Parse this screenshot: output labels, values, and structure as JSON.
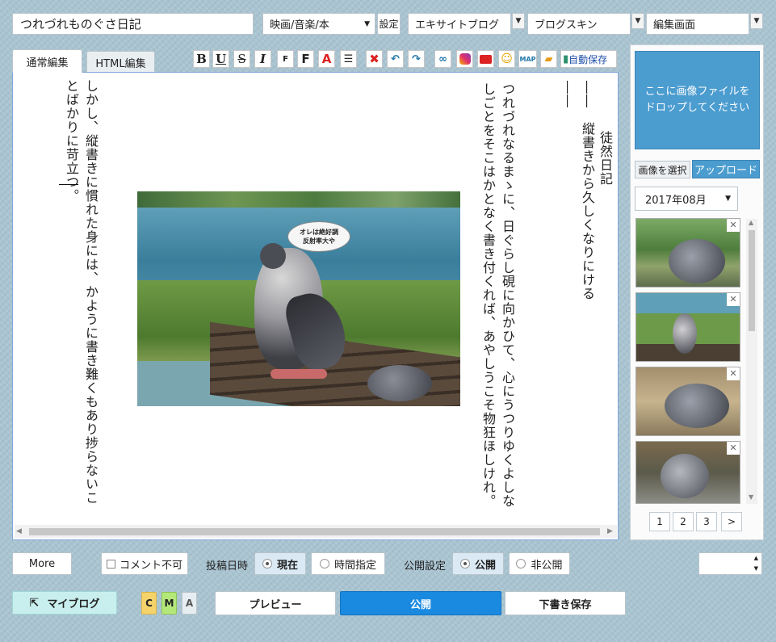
{
  "header": {
    "title": "つれづれものぐさ日記",
    "category": "映画/音楽/本",
    "settings": "設定",
    "blog": "エキサイトブログ",
    "skin": "ブログスキン",
    "screen": "編集画面"
  },
  "tabs": {
    "normal": "通常編集",
    "html": "HTML編集"
  },
  "toolbar": {
    "autosave": "自動保存",
    "map": "MAP"
  },
  "editor": {
    "title_vertical": "徒然日記",
    "line2": "――　縦書きから久しくなりにける――",
    "line3": "つれづれなるまゝに、日ぐらし硯に向かひて、心にうつりゆくよしなしごとをそこはかとなく書き付くれば、あやしうこそ物狂ほしけれ。",
    "line4": "しかし、縦書きに慣れた身には、かように書き難くもあり捗らないことばかりに苛立つ。",
    "speech": "オレは絶好調\n反射率大や"
  },
  "side": {
    "drop": "ここに画像ファイルを\nドロップしてください",
    "select": "画像を選択",
    "upload": "アップロード",
    "month": "2017年08月",
    "pages": [
      "1",
      "2",
      "3",
      ">"
    ]
  },
  "bottom": {
    "more": "More",
    "no_comment": "コメント不可",
    "post_time": "投稿日時",
    "now": "現在",
    "specify": "時間指定",
    "visibility": "公開設定",
    "public": "公開",
    "private": "非公開"
  },
  "actions": {
    "myblog": "マイブログ",
    "c": "C",
    "m": "M",
    "a": "A",
    "preview": "プレビュー",
    "publish": "公開",
    "draft": "下書き保存"
  }
}
